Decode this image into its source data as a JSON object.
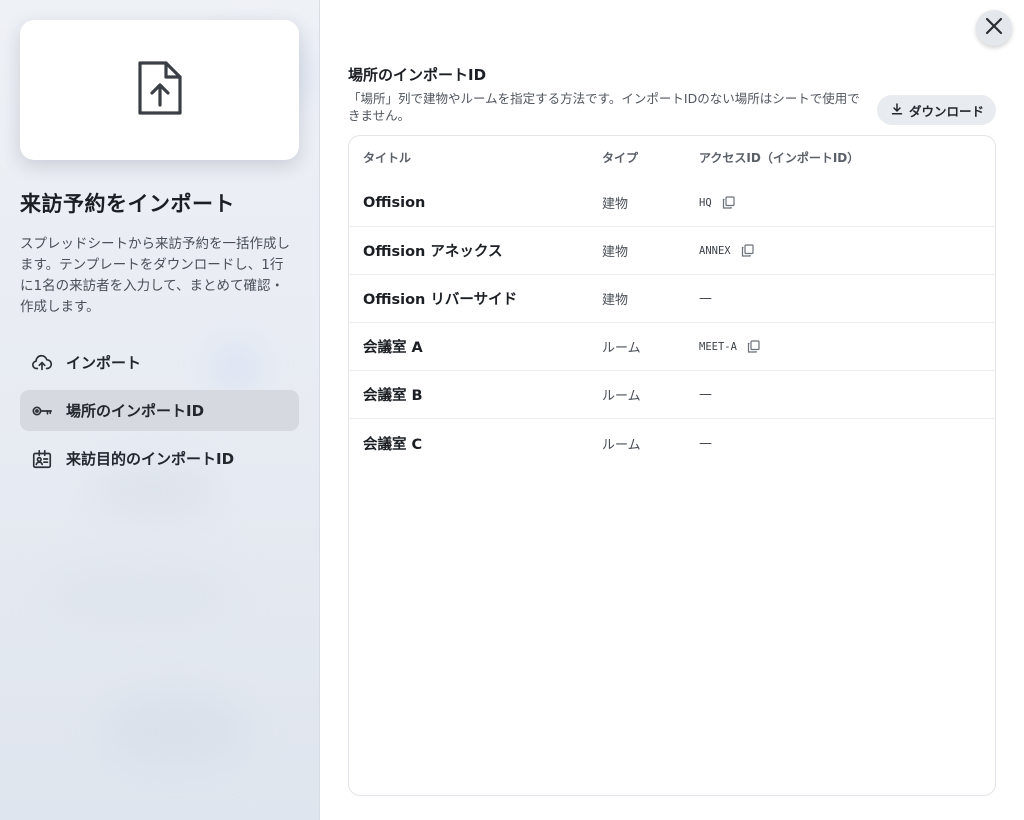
{
  "sidebar": {
    "title": "来訪予約をインポート",
    "description": "スプレッドシートから来訪予約を一括作成します。テンプレートをダウンロードし、1行に1名の来訪者を入力して、まとめて確認・作成します。",
    "items": [
      {
        "label": "インポート",
        "icon": "cloud-upload-icon",
        "active": false
      },
      {
        "label": "場所のインポートID",
        "icon": "key-icon",
        "active": true
      },
      {
        "label": "来訪目的のインポートID",
        "icon": "id-badge-icon",
        "active": false
      }
    ]
  },
  "main": {
    "title": "場所のインポートID",
    "description": "「場所」列で建物やルームを指定する方法です。インポートIDのない場所はシートで使用できません。",
    "download_label": "ダウンロード",
    "table": {
      "headers": [
        "タイトル",
        "タイプ",
        "アクセスID（インポートID）"
      ],
      "rows": [
        {
          "title": "Offision",
          "type": "建物",
          "id": "HQ"
        },
        {
          "title": "Offision アネックス",
          "type": "建物",
          "id": "ANNEX"
        },
        {
          "title": "Offision リバーサイド",
          "type": "建物",
          "id": "—"
        },
        {
          "title": "会議室 A",
          "type": "ルーム",
          "id": "MEET-A"
        },
        {
          "title": "会議室 B",
          "type": "ルーム",
          "id": "—"
        },
        {
          "title": "会議室 C",
          "type": "ルーム",
          "id": "—"
        }
      ]
    }
  },
  "colors": {
    "active_nav_bg": "#d6d9df",
    "text_primary": "#1b1f24",
    "text_secondary": "#4a5058"
  }
}
